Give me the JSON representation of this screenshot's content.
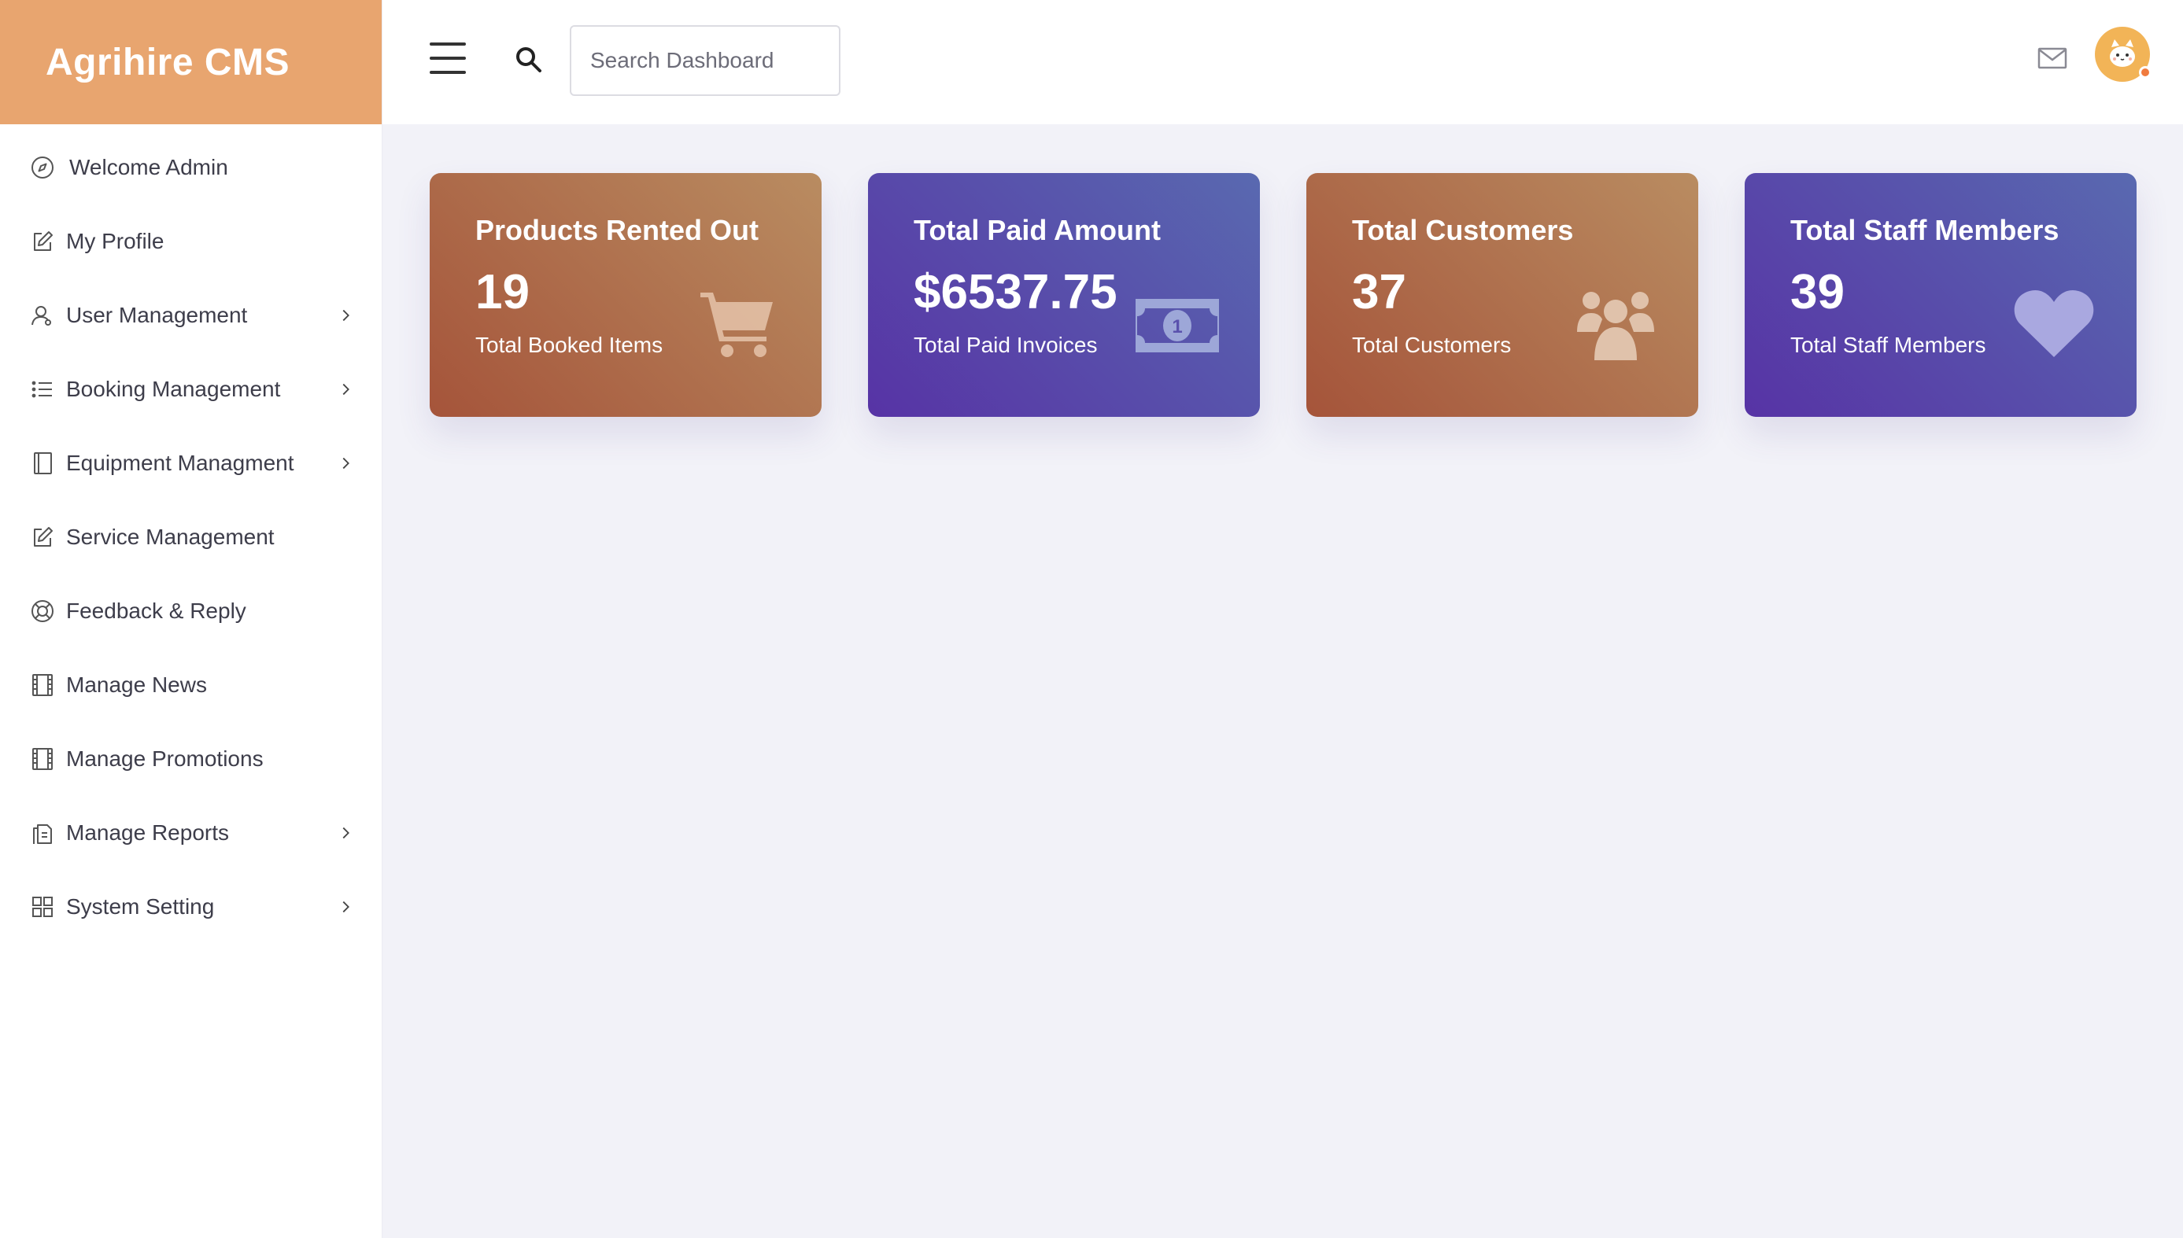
{
  "brand": {
    "title": "Agrihire CMS",
    "color": "#e8a56f"
  },
  "sidebar": {
    "items": [
      {
        "label": "Welcome Admin",
        "icon": "compass-icon",
        "has_submenu": false
      },
      {
        "label": "My Profile",
        "icon": "edit-icon",
        "has_submenu": false
      },
      {
        "label": "User Management",
        "icon": "user-icon",
        "has_submenu": true
      },
      {
        "label": "Booking Management",
        "icon": "list-icon",
        "has_submenu": true
      },
      {
        "label": "Equipment Managment",
        "icon": "notebook-icon",
        "has_submenu": true
      },
      {
        "label": "Service Management",
        "icon": "edit-icon",
        "has_submenu": false
      },
      {
        "label": "Feedback & Reply",
        "icon": "lifebuoy-icon",
        "has_submenu": false
      },
      {
        "label": "Manage News",
        "icon": "film-icon",
        "has_submenu": false
      },
      {
        "label": "Manage Promotions",
        "icon": "film-icon",
        "has_submenu": false
      },
      {
        "label": "Manage Reports",
        "icon": "copy-icon",
        "has_submenu": true
      },
      {
        "label": "System Setting",
        "icon": "grid-icon",
        "has_submenu": true
      }
    ]
  },
  "topbar": {
    "search_placeholder": "Search Dashboard",
    "search_value": ""
  },
  "cards": [
    {
      "title": "Products Rented Out",
      "value": "19",
      "subtitle": "Total Booked Items",
      "icon": "cart-icon",
      "color": "orange"
    },
    {
      "title": "Total Paid Amount",
      "value": "$6537.75",
      "subtitle": "Total Paid Invoices",
      "icon": "money-icon",
      "color": "purple"
    },
    {
      "title": "Total Customers",
      "value": "37",
      "subtitle": "Total Customers",
      "icon": "users-icon",
      "color": "orange"
    },
    {
      "title": "Total Staff Members",
      "value": "39",
      "subtitle": "Total Staff Members",
      "icon": "heart-icon",
      "color": "purple"
    }
  ],
  "colors": {
    "orange_gradient_start": "#a5543a",
    "orange_gradient_end": "#b98c61",
    "purple_gradient_start": "#5733a5",
    "purple_gradient_end": "#5969b0",
    "background": "#f2f2f8"
  }
}
